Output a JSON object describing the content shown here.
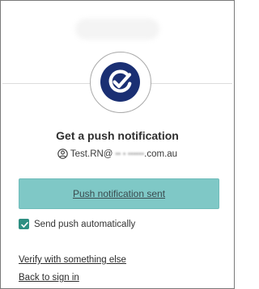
{
  "brand": {
    "ring_color": "#a9a9a9",
    "disc_color": "#1a2f73",
    "accent_button_color": "#7fc8c6",
    "checkbox_color": "#2e8f82"
  },
  "auth": {
    "icon": "okta-verify-check-icon",
    "title": "Get a push notification",
    "account_prefix": "Test.RN@",
    "account_domain": ".com.au",
    "user_icon": "user-circle-icon"
  },
  "push_button": {
    "label": "Push notification sent"
  },
  "send_push": {
    "checked": true,
    "label": "Send push automatically"
  },
  "links": {
    "verify_other": "Verify with something else",
    "back_to_sign_in": "Back to sign in"
  }
}
